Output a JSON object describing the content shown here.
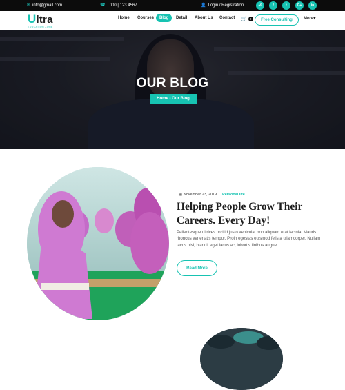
{
  "topbar": {
    "email": "info@gmail.com",
    "phone": "| 000 | 123 4567",
    "login": "Login / Registration",
    "socials": [
      {
        "icon": "rss-icon",
        "glyph": "☍"
      },
      {
        "icon": "facebook-icon",
        "glyph": "f"
      },
      {
        "icon": "twitter-icon",
        "glyph": "t"
      },
      {
        "icon": "google-plus-icon",
        "glyph": "G+"
      },
      {
        "icon": "linkedin-icon",
        "glyph": "in"
      }
    ]
  },
  "logo": {
    "first": "U",
    "rest": "ltra",
    "tagline": "EDUCATION ZONE"
  },
  "nav": {
    "items": [
      "Home",
      "Courses",
      "Blog",
      "Detail",
      "About Us",
      "Contact"
    ],
    "active": "Blog",
    "cart_count": "0",
    "consult": "Free Consulting",
    "more": "More"
  },
  "hero": {
    "title": "OUR BLOG",
    "breadcrumb": "Home - Our Blog"
  },
  "post": {
    "date": "November 23, 2019",
    "category": "Personal life",
    "title": "Helping People Grow Their Careers. Every Day!",
    "excerpt": "Pellentesque ultrices orci id justo vehicula, non aliquam erat lacinia. Mauris rhoncus venenatis tempor. Proin egestas euismod felis a ullamcorper. Nullam lacus nisi, blandit eget lacus ac, lobortis finibus augue.",
    "read_more": "Read More"
  },
  "colors": {
    "accent": "#17c3b2",
    "topbar": "#0c0c0c"
  }
}
